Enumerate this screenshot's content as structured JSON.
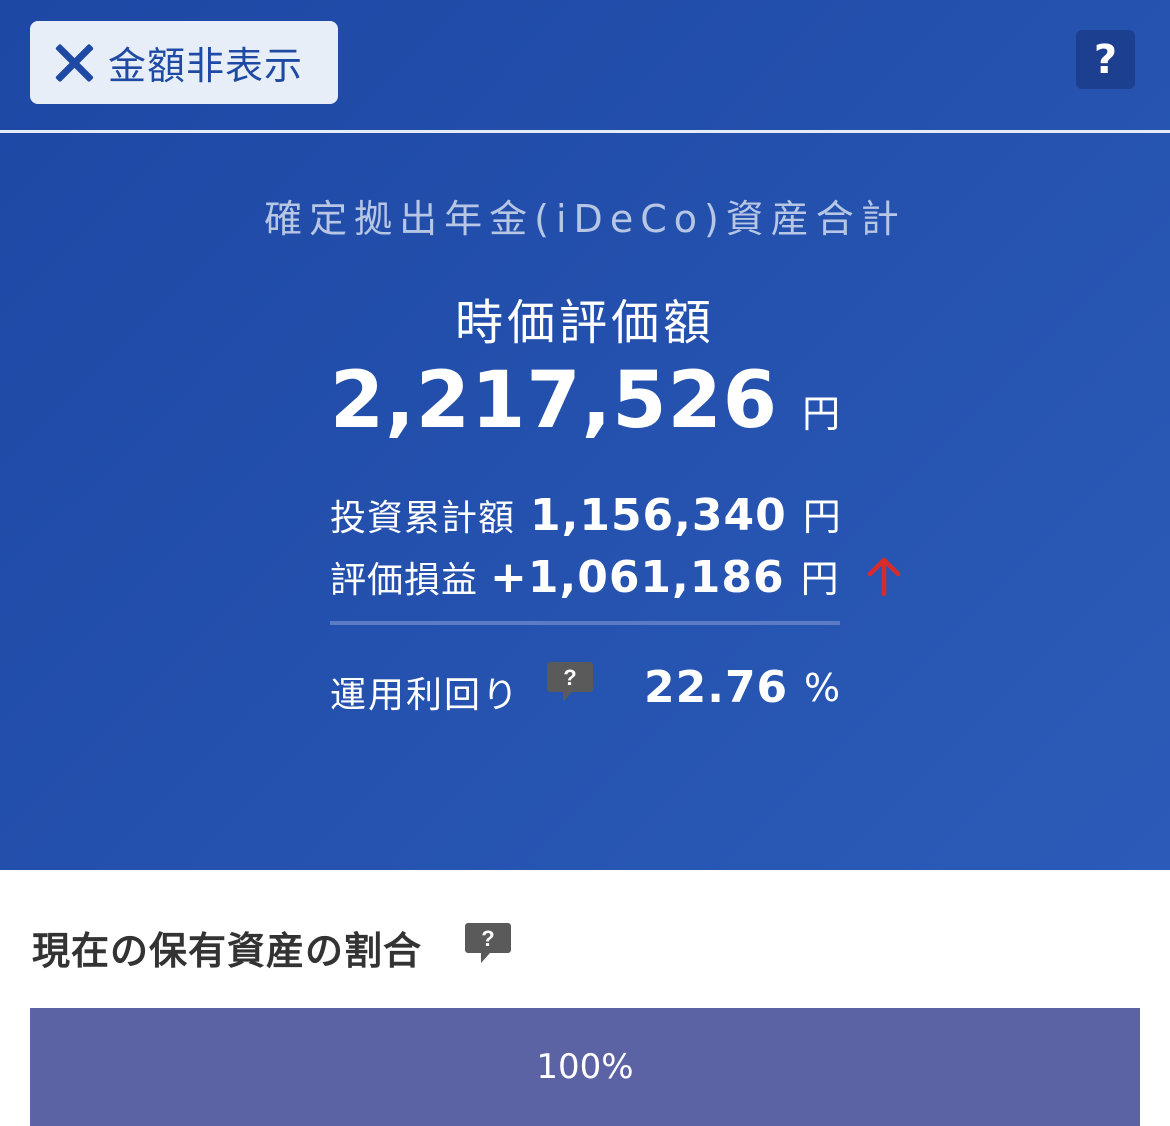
{
  "header": {
    "hide_amount_label": "金額非表示",
    "help_label": "?"
  },
  "summary": {
    "title": "確定拠出年金(iDeCo)資産合計",
    "market_value_label": "時価評価額",
    "market_value": "2,217,526",
    "market_value_unit": "円",
    "invested_label": "投資累計額",
    "invested_value": "1,156,340",
    "invested_unit": "円",
    "gain_label": "評価損益",
    "gain_value": "+1,061,186",
    "gain_unit": "円",
    "gain_direction_icon": "arrow-up-icon",
    "gain_color": "#d92b2b",
    "yield_label": "運用利回り",
    "yield_help": "?",
    "yield_value": "22.76",
    "yield_unit": "%"
  },
  "allocation": {
    "title": "現在の保有資産の割合",
    "help": "?",
    "segments": [
      {
        "percent_label": "100%",
        "share": 1.0,
        "color": "#5c63a4"
      }
    ]
  },
  "colors": {
    "hero_bg": "#2450ad",
    "bubble": "#5a5a5a"
  }
}
